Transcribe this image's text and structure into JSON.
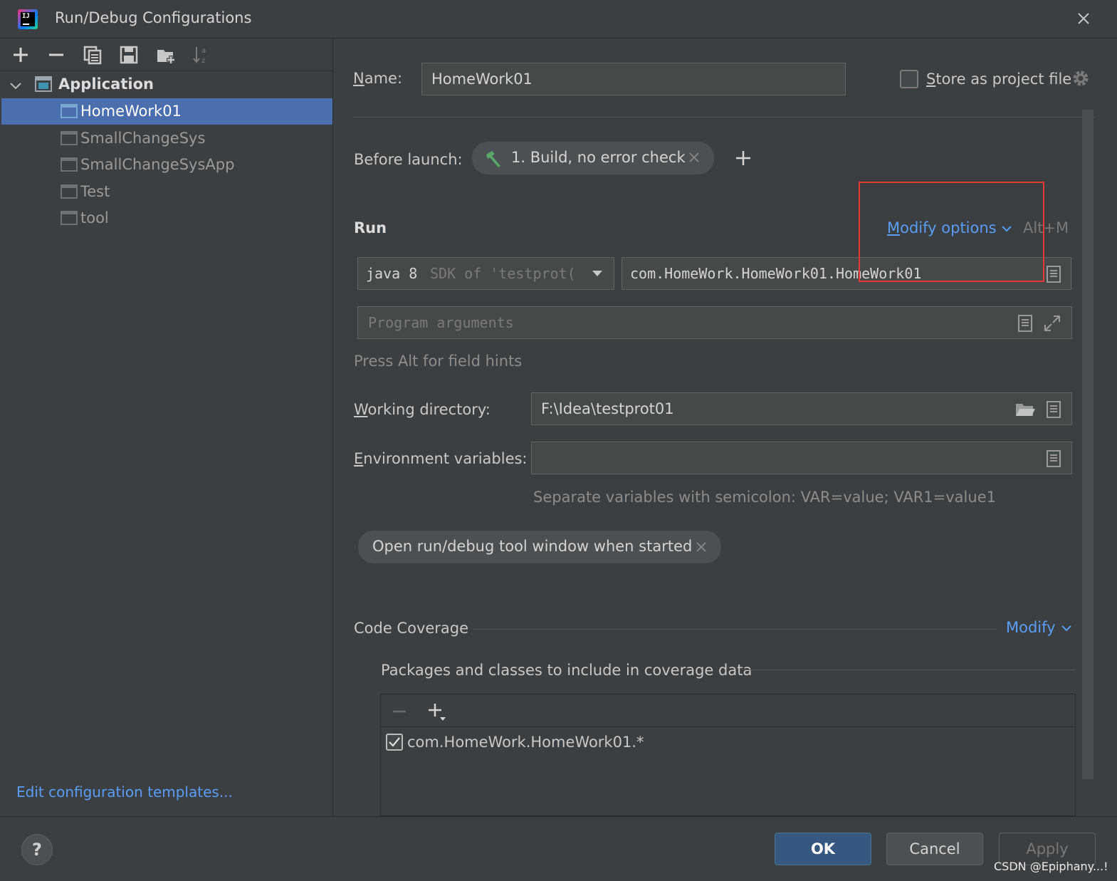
{
  "window": {
    "title": "Run/Debug Configurations",
    "logo_text": "IJ"
  },
  "left_toolbar": {
    "icons": [
      "add-icon",
      "remove-icon",
      "copy-icon",
      "save-icon",
      "new-folder-icon",
      "sort-icon"
    ]
  },
  "tree": {
    "group_label": "Application",
    "items": [
      {
        "label": "HomeWork01",
        "selected": true
      },
      {
        "label": "SmallChangeSys",
        "selected": false
      },
      {
        "label": "SmallChangeSysApp",
        "selected": false
      },
      {
        "label": "Test",
        "selected": false
      },
      {
        "label": "tool",
        "selected": false
      }
    ]
  },
  "edit_templates_link": "Edit configuration templates...",
  "name_label_first": "N",
  "name_label_rest": "ame:",
  "name_value": "HomeWork01",
  "store_as_project_file": {
    "label_first": "S",
    "label_rest": "tore as project file",
    "checked": false
  },
  "before_launch": {
    "label": "Before launch:",
    "task": "1. Build, no error check"
  },
  "run": {
    "section_title": "Run",
    "modify_options_first": "M",
    "modify_options_rest": "odify options",
    "modify_shortcut": "Alt+M",
    "jre_value": "java 8",
    "jre_hint": "SDK of 'testprot(",
    "main_class": "com.HomeWork.HomeWork01.HomeWork01",
    "program_args_placeholder": "Program arguments",
    "field_hint": "Press Alt for field hints",
    "working_dir_label_first": "W",
    "working_dir_label_rest": "orking directory:",
    "working_dir_value": "F:\\Idea\\testprot01",
    "env_label_first": "E",
    "env_label_rest": "nvironment variables:",
    "env_value": "",
    "env_hint": "Separate variables with semicolon: VAR=value; VAR1=value1",
    "option_chip": "Open run/debug tool window when started"
  },
  "code_coverage": {
    "title": "Code Coverage",
    "modify_label": "Modify",
    "packages_title": "Packages and classes to include in coverage data",
    "patterns": [
      {
        "pattern": "com.HomeWork.HomeWork01.*",
        "checked": true
      }
    ]
  },
  "footer": {
    "help": "?",
    "ok": "OK",
    "cancel": "Cancel",
    "apply": "Apply",
    "watermark": "CSDN @Epiphany...!"
  },
  "colors": {
    "accent_link": "#589df6",
    "selection": "#4b6eaf",
    "ok_button": "#365880",
    "annotation_box": "#e53935"
  }
}
